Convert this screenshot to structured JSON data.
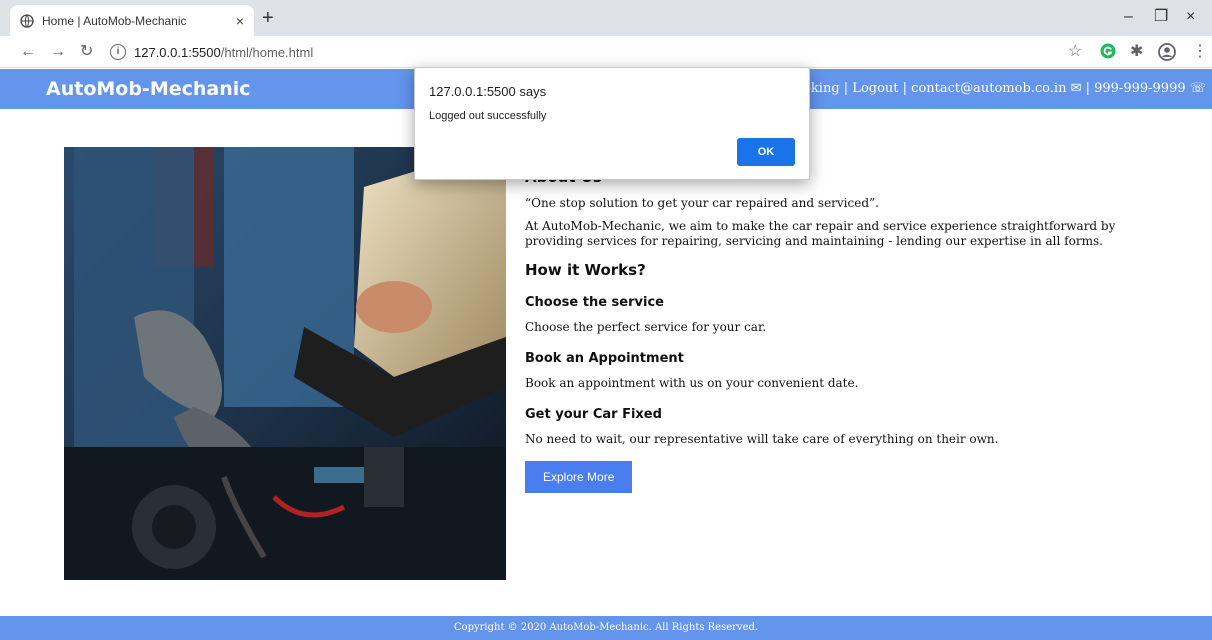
{
  "browser": {
    "tab_title": "Home | AutoMob-Mechanic",
    "tab_close": "×",
    "new_tab": "+",
    "url_main": "127.0.0.1:5500",
    "url_rest": "/html/home.html",
    "window_controls": {
      "minimize": "–",
      "restore": "❐",
      "close": "×"
    }
  },
  "header": {
    "brand": "AutoMob-Mechanic",
    "nav_text": "es | Booking | Logout | contact@automob.co.in ✉ | 999-999-9999 ☏"
  },
  "main": {
    "about_heading": "About Us",
    "tagline": "“One stop solution to get your car repaired and serviced”.",
    "about_text": "At AutoMob-Mechanic, we aim to make the car repair and service experience straightforward by providing services for repairing, servicing and maintaining - lending our expertise in all forms.",
    "how_heading": "How it Works?",
    "steps": [
      {
        "title": "Choose the service",
        "text": "Choose the perfect service for your car."
      },
      {
        "title": "Book an Appointment",
        "text": "Book an appointment with us on your convenient date."
      },
      {
        "title": "Get your Car Fixed",
        "text": "No need to wait, our representative will take care of everything on their own."
      }
    ],
    "explore_label": "Explore More"
  },
  "footer": {
    "copyright": "Copyright © 2020 AutoMob-Mechanic.  All Rights Reserved."
  },
  "dialog": {
    "origin": "127.0.0.1:5500 says",
    "message": "Logged out successfully",
    "ok_label": "OK"
  },
  "colors": {
    "brand_blue": "#6495ed",
    "button_blue": "#4a7ef0",
    "dialog_ok": "#1a73e8"
  }
}
